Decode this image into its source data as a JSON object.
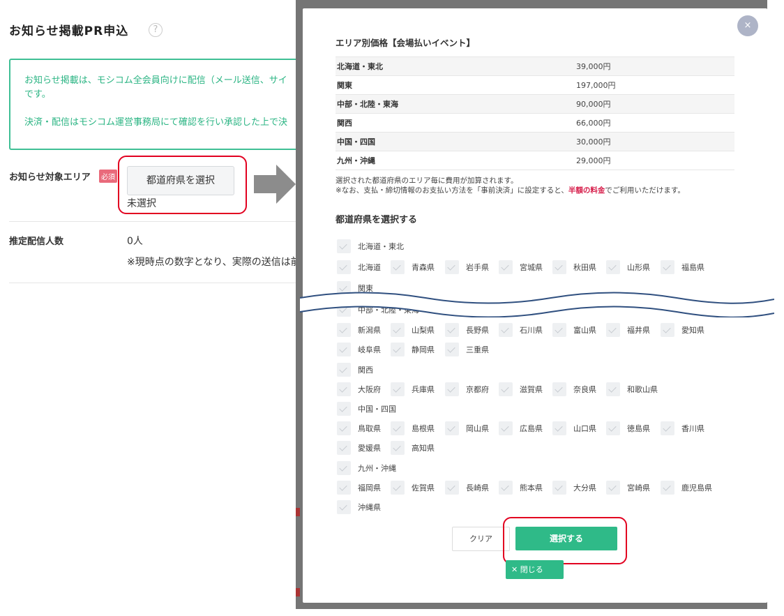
{
  "page": {
    "title": "お知らせ掲載PR申込",
    "help_icon": "?",
    "notice_line1": "お知らせ掲載は、モシコム全会員向けに配信（メール送信、サイ",
    "notice_line1b": "です。",
    "notice_line2": "決済・配信はモシコム運営事務局にて確認を行い承認した上で決",
    "area_label": "お知らせ対象エリア",
    "required_badge": "必須",
    "select_prefecture_button": "都道府県を選択",
    "area_value": "未選択",
    "recipients_label": "推定配信人数",
    "recipients_value": "0人",
    "recipients_note": "※現時点の数字となり、実際の送信は前"
  },
  "modal": {
    "close_icon": "×",
    "price_title": "エリア別価格【会場払いイベント】",
    "prices": [
      {
        "area": "北海道・東北",
        "price": "39,000円"
      },
      {
        "area": "関東",
        "price": "197,000円"
      },
      {
        "area": "中部・北陸・東海",
        "price": "90,000円"
      },
      {
        "area": "関西",
        "price": "66,000円"
      },
      {
        "area": "中国・四国",
        "price": "30,000円"
      },
      {
        "area": "九州・沖縄",
        "price": "29,000円"
      }
    ],
    "note_line1": "選択された都道府県のエリア毎に費用が加算されます。",
    "note_line2_pre": "※なお、支払・締切情報のお支払い方法を「事前決済」に設定すると、",
    "note_line2_strong": "半額の料金",
    "note_line2_post": "でご利用いただけます。",
    "select_title": "都道府県を選択する",
    "regions": {
      "r1": "北海道・東北",
      "r2": "関東",
      "r3": "中部・北陸・東海",
      "r4": "関西",
      "r5": "中国・四国",
      "r6": "九州・沖縄"
    },
    "prefectures": {
      "hokkaido": "北海道",
      "aomori": "青森県",
      "iwate": "岩手県",
      "miyagi": "宮城県",
      "akita": "秋田県",
      "yamagata": "山形県",
      "fukushima": "福島県",
      "niigata": "新潟県",
      "yamanashi": "山梨県",
      "nagano": "長野県",
      "ishikawa": "石川県",
      "toyama": "富山県",
      "fukui": "福井県",
      "aichi": "愛知県",
      "gifu": "岐阜県",
      "shizuoka": "静岡県",
      "mie": "三重県",
      "osaka": "大阪府",
      "hyogo": "兵庫県",
      "kyoto": "京都府",
      "shiga": "滋賀県",
      "nara": "奈良県",
      "wakayama": "和歌山県",
      "tottori": "鳥取県",
      "shimane": "島根県",
      "okayama": "岡山県",
      "hiroshima": "広島県",
      "yamaguchi": "山口県",
      "tokushima": "徳島県",
      "kagawa": "香川県",
      "ehime": "愛媛県",
      "kochi": "高知県",
      "fukuoka": "福岡県",
      "saga": "佐賀県",
      "nagasaki": "長崎県",
      "kumamoto": "熊本県",
      "oita": "大分県",
      "miyazaki": "宮崎県",
      "kagoshima": "鹿児島県",
      "okinawa": "沖縄県"
    },
    "clear_button": "クリア",
    "select_button": "選択する",
    "close_button": "✕ 閉じる"
  },
  "colors": {
    "accent_green": "#2fba88",
    "highlight_red": "#e20020",
    "badge_pink": "#e96a7b"
  }
}
